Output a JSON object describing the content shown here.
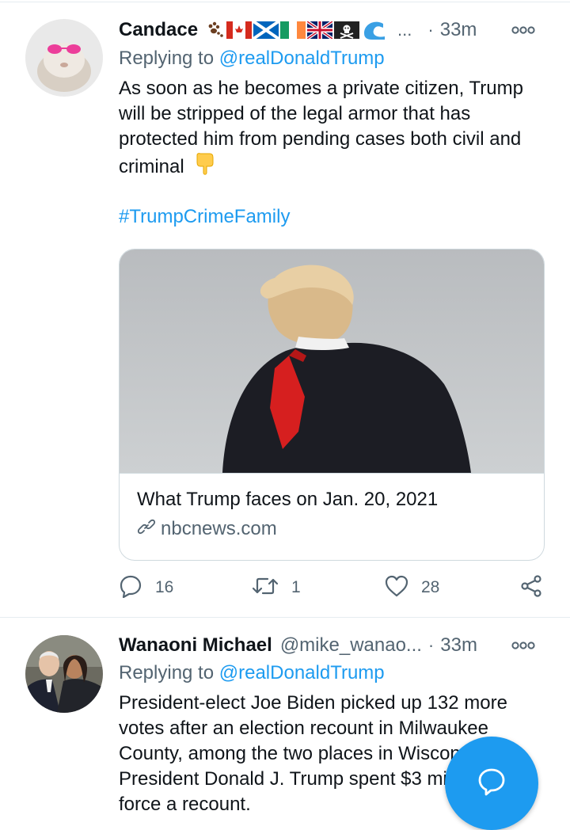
{
  "tweets": [
    {
      "display_name": "Candace",
      "name_suffix": "...",
      "separator": "·",
      "time": "33m",
      "reply_prefix": "Replying to",
      "reply_mention": "@realDonaldTrump",
      "text": "As soon as he becomes a private citizen, Trump will be stripped of the legal armor that has protected him from pending cases both civil and criminal",
      "hashtag": "#TrumpCrimeFamily",
      "emojis": [
        "paw-prints",
        "flag-canada",
        "flag-scotland",
        "flag-ireland",
        "flag-uk",
        "pirate-flag",
        "water-wave"
      ],
      "card": {
        "title": "What Trump faces on Jan. 20, 2021",
        "domain": "nbcnews.com"
      },
      "stats": {
        "replies": "16",
        "retweets": "1",
        "likes": "28"
      }
    },
    {
      "display_name": "Wanaoni Michael",
      "handle": "@mike_wanao...",
      "separator": "·",
      "time": "33m",
      "reply_prefix": "Replying to",
      "reply_mention": "@realDonaldTrump",
      "text": "President-elect Joe Biden picked up 132 more votes after an election recount in Milwaukee County, among the two places in Wisconsin that President Donald J. Trump spent $3 million to force a recount."
    }
  ],
  "colors": {
    "accent": "#1d9bf0",
    "text": "#0f1419",
    "secondary": "#536471",
    "border": "#cfd9de"
  },
  "icons": {
    "more": "more-icon",
    "reply": "reply-icon",
    "retweet": "retweet-icon",
    "like": "heart-icon",
    "share": "share-icon",
    "link": "link-icon",
    "compose": "compose-icon"
  }
}
